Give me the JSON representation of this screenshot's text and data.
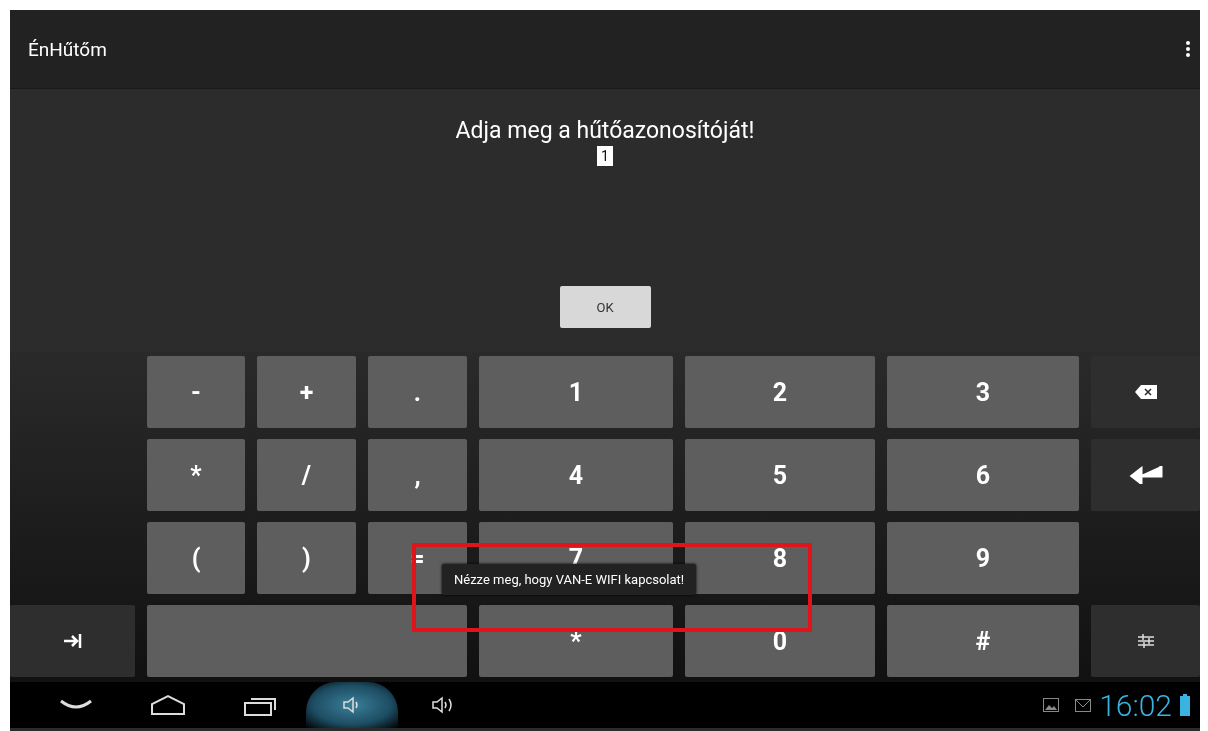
{
  "action_bar": {
    "title": "ÉnHűtőm"
  },
  "prompt": "Adja meg a hűtőazonosítóját!",
  "id_field": {
    "value": "1"
  },
  "ok_button": "OK",
  "keyboard": {
    "rows": [
      [
        {
          "kind": "blank"
        },
        {
          "kind": "key",
          "label": "-"
        },
        {
          "kind": "key",
          "label": "+"
        },
        {
          "kind": "key",
          "label": "."
        },
        {
          "kind": "key",
          "label": "1"
        },
        {
          "kind": "key",
          "label": "2"
        },
        {
          "kind": "key",
          "label": "3"
        },
        {
          "kind": "backspace"
        }
      ],
      [
        {
          "kind": "blank"
        },
        {
          "kind": "key",
          "label": "*"
        },
        {
          "kind": "key",
          "label": "/"
        },
        {
          "kind": "key",
          "label": ","
        },
        {
          "kind": "key",
          "label": "4"
        },
        {
          "kind": "key",
          "label": "5"
        },
        {
          "kind": "key",
          "label": "6"
        },
        {
          "kind": "enter"
        }
      ],
      [
        {
          "kind": "blank"
        },
        {
          "kind": "key",
          "label": "("
        },
        {
          "kind": "key",
          "label": ")"
        },
        {
          "kind": "key",
          "label": "="
        },
        {
          "kind": "key",
          "label": "7"
        },
        {
          "kind": "key",
          "label": "8"
        },
        {
          "kind": "key",
          "label": "9"
        },
        {
          "kind": "blank"
        }
      ],
      [
        {
          "kind": "tab"
        },
        {
          "kind": "space"
        },
        "",
        "",
        {
          "kind": "key",
          "label": "*"
        },
        {
          "kind": "key",
          "label": "0"
        },
        {
          "kind": "key",
          "label": "#"
        },
        {
          "kind": "settings"
        }
      ]
    ]
  },
  "toast": "Nézze meg, hogy VAN-E WIFI kapcsolat!",
  "nav_bar": {
    "buttons": [
      {
        "kind": "back",
        "pressed": false
      },
      {
        "kind": "home",
        "pressed": false
      },
      {
        "kind": "recents",
        "pressed": false
      },
      {
        "kind": "volume_down",
        "pressed": true
      },
      {
        "kind": "volume_up",
        "pressed": false
      }
    ],
    "status": {
      "time": "16:02"
    }
  }
}
